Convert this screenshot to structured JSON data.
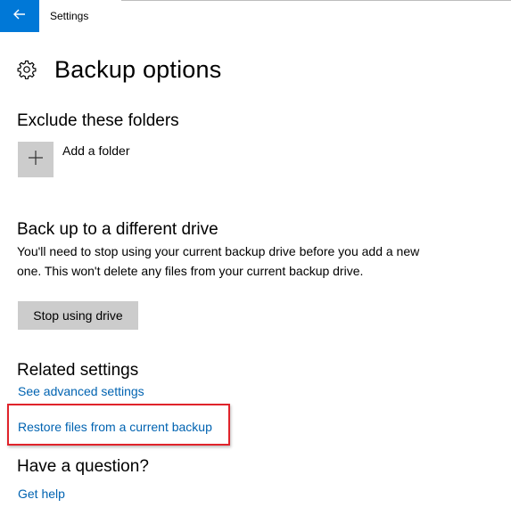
{
  "window": {
    "title": "Settings",
    "accent_color": "#0078d7",
    "back_icon": "arrow-left-icon"
  },
  "page": {
    "icon": "gear-icon",
    "title": "Backup options"
  },
  "exclude_section": {
    "header": "Exclude these folders",
    "add_folder_icon": "plus-icon",
    "add_folder_label": "Add a folder"
  },
  "different_drive_section": {
    "header": "Back up to a different drive",
    "description": "You'll need to stop using your current backup drive before you add a new one. This won't delete any files from your current backup drive.",
    "stop_button_label": "Stop using drive"
  },
  "related_settings": {
    "header": "Related settings",
    "links": [
      {
        "label": "See advanced settings"
      },
      {
        "label": "Restore files from a current backup",
        "highlighted": true
      }
    ],
    "link_color": "#0063b1",
    "highlight_color": "#e0232b"
  },
  "question_section": {
    "header": "Have a question?",
    "help_link": "Get help"
  }
}
